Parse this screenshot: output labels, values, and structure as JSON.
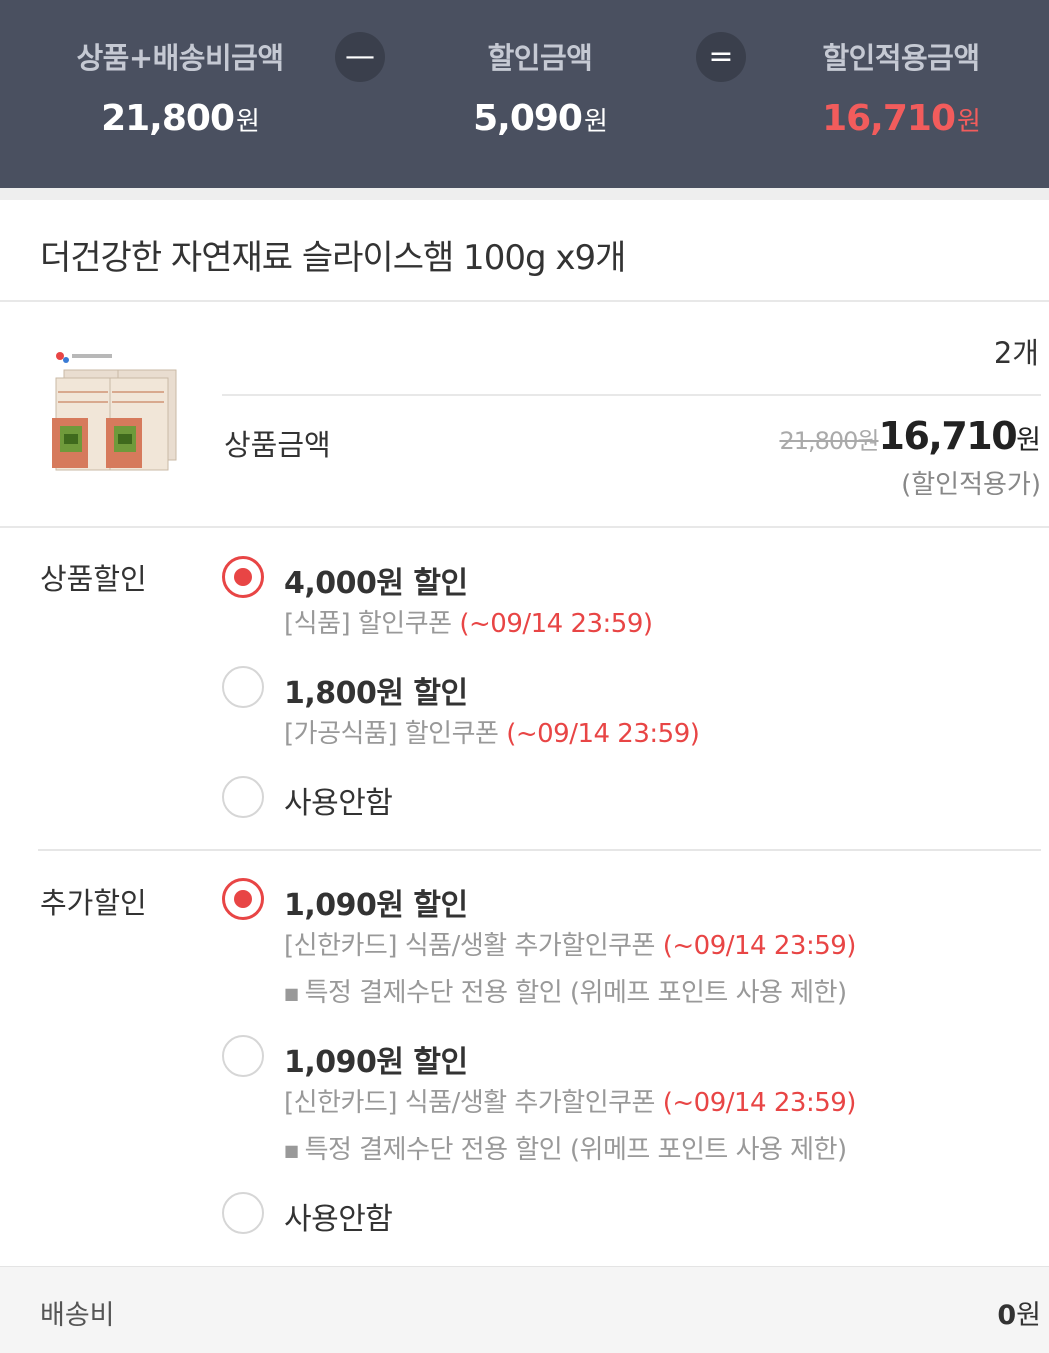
{
  "summary": {
    "subtotal_label": "상품+배송비금액",
    "subtotal_value": "21,800",
    "minus_symbol": "—",
    "discount_label": "할인금액",
    "discount_value": "5,090",
    "equals_symbol": "=",
    "total_label": "할인적용금액",
    "total_value": "16,710",
    "currency": "원"
  },
  "product": {
    "title": "더건강한 자연재료 슬라이스햄 100g x9개",
    "thumbnail": "product-thumbnail-ham-packs",
    "quantity": "2개",
    "price_label": "상품금액",
    "original_price": "21,800원",
    "final_price": "16,710",
    "final_unit": "원",
    "price_note": "(할인적용가)"
  },
  "product_discount": {
    "label": "상품할인",
    "options": [
      {
        "title": "4,000원 할인",
        "coupon": "[식품] 할인쿠폰 ",
        "deadline": "(~09/14 23:59)",
        "selected": true
      },
      {
        "title": "1,800원 할인",
        "coupon": "[가공식품] 할인쿠폰 ",
        "deadline": "(~09/14 23:59)",
        "selected": false
      },
      {
        "title": "사용안함",
        "selected": false
      }
    ]
  },
  "extra_discount": {
    "label": "추가할인",
    "options": [
      {
        "title": "1,090원 할인",
        "coupon": "[신한카드] 식품/생활 추가할인쿠폰 ",
        "deadline": "(~09/14 23:59)",
        "note": "특정 결제수단 전용 할인 (위메프 포인트 사용 제한)",
        "selected": true
      },
      {
        "title": "1,090원 할인",
        "coupon": "[신한카드] 식품/생활 추가할인쿠폰 ",
        "deadline": "(~09/14 23:59)",
        "note": "특정 결제수단 전용 할인 (위메프 포인트 사용 제한)",
        "selected": false
      },
      {
        "title": "사용안함",
        "selected": false
      }
    ]
  },
  "shipping": {
    "label": "배송비",
    "value": "0",
    "unit": "원"
  },
  "colors": {
    "header_bg": "#4a5060",
    "accent_red": "#e84545",
    "total_red": "#f25c5c"
  }
}
